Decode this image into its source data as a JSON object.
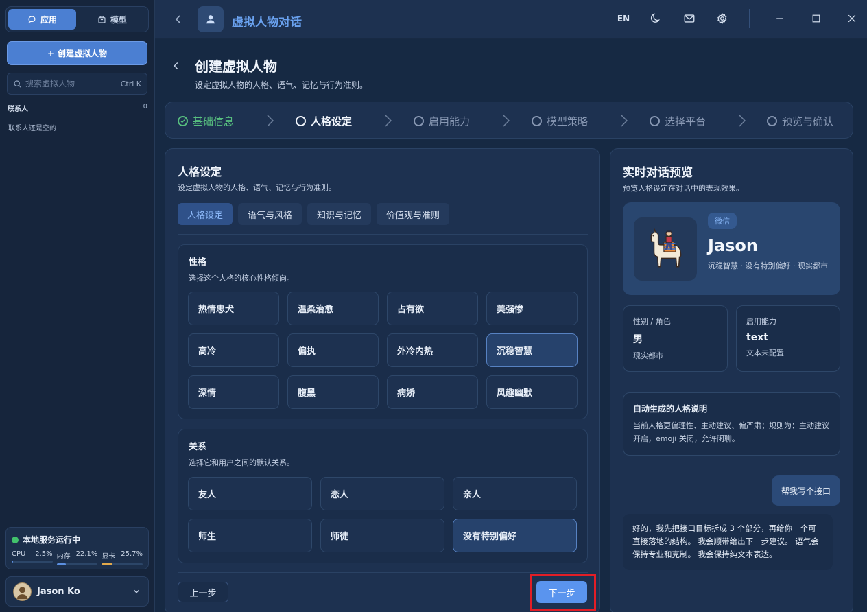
{
  "sidebar": {
    "tabs": [
      {
        "label": "应用",
        "icon": "chat-icon",
        "active": true
      },
      {
        "label": "模型",
        "icon": "box-icon",
        "active": false
      }
    ],
    "create_label": "创建虚拟人物",
    "search_placeholder": "搜索虚拟人物",
    "search_shortcut": "Ctrl K",
    "contacts_label": "联系人",
    "contacts_count": "0",
    "contacts_empty": "联系人还是空的",
    "status": {
      "title": "本地服务运行中",
      "metrics": [
        {
          "label": "CPU",
          "value": "2.5%",
          "percent": 2.5,
          "color": "#5b8fe0"
        },
        {
          "label": "内存",
          "value": "22.1%",
          "percent": 22.1,
          "color": "#5b8fe0"
        },
        {
          "label": "显卡",
          "value": "25.7%",
          "percent": 25.7,
          "color": "#e2a94b"
        }
      ]
    },
    "user_name": "Jason Ko"
  },
  "topbar": {
    "title": "虚拟人物对话",
    "lang": "EN"
  },
  "page": {
    "title": "创建虚拟人物",
    "subtitle": "设定虚拟人物的人格、语气、记忆与行为准则。"
  },
  "steps": [
    {
      "label": "基础信息",
      "state": "done"
    },
    {
      "label": "人格设定",
      "state": "active"
    },
    {
      "label": "启用能力",
      "state": "todo"
    },
    {
      "label": "模型策略",
      "state": "todo"
    },
    {
      "label": "选择平台",
      "state": "todo"
    },
    {
      "label": "预览与确认",
      "state": "todo"
    }
  ],
  "persona": {
    "title": "人格设定",
    "subtitle": "设定虚拟人物的人格、语气、记忆与行为准则。",
    "tabs": [
      "人格设定",
      "语气与风格",
      "知识与记忆",
      "价值观与准则"
    ],
    "personality": {
      "title": "性格",
      "subtitle": "选择这个人格的核心性格倾向。",
      "options": [
        "热情忠犬",
        "温柔治愈",
        "占有欲",
        "美强惨",
        "高冷",
        "偏执",
        "外冷内热",
        "沉稳智慧",
        "深情",
        "腹黑",
        "病娇",
        "风趣幽默"
      ],
      "selected": "沉稳智慧"
    },
    "relation": {
      "title": "关系",
      "subtitle": "选择它和用户之间的默认关系。",
      "options": [
        "友人",
        "恋人",
        "亲人",
        "师生",
        "师徒",
        "没有特别偏好"
      ],
      "selected": "没有特别偏好"
    },
    "prev_label": "上一步",
    "next_label": "下一步"
  },
  "preview": {
    "title": "实时对话预览",
    "subtitle": "预览人格设定在对话中的表现效果。",
    "badge": "微信",
    "name": "Jason",
    "desc": "沉稳智慧 · 没有特别偏好 · 现实都市",
    "gender_label": "性别 / 角色",
    "gender_value": "男",
    "gender_note": "现实都市",
    "ability_label": "启用能力",
    "ability_value": "text",
    "ability_note": "文本未配置",
    "auto_title": "自动生成的人格说明",
    "auto_text": "当前人格更偏理性、主动建议、偏严肃；规则为：主动建议开启，emoji 关闭，允许闲聊。",
    "user_msg": "帮我写个接口",
    "bot_msg": "好的，我先把接口目标拆成 3 个部分，再给你一个可直接落地的结构。 我会顺带给出下一步建议。 语气会保持专业和克制。 我会保持纯文本表达。"
  }
}
